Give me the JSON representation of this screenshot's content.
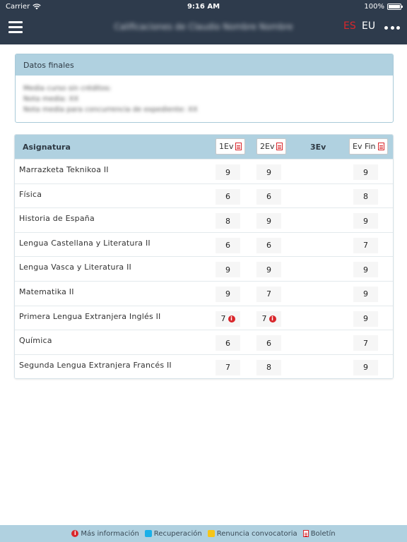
{
  "statusbar": {
    "carrier": "Carrier",
    "time": "9:16 AM",
    "battery": "100%"
  },
  "navbar": {
    "title": "Calificaciones de Claudio Nombre Nombre",
    "lang_es": "ES",
    "lang_eu": "EU"
  },
  "final": {
    "header": "Datos finales",
    "lines": [
      "Media curso sin créditos:",
      "Nota media: XX",
      "Nota media para concurrencia de expediente: XX"
    ]
  },
  "grades": {
    "header": {
      "subject": "Asignatura",
      "ev1": "1Ev",
      "ev2": "2Ev",
      "ev3": "3Ev",
      "evfin": "Ev Fin"
    },
    "rows": [
      {
        "subject": "Marrazketa Teknikoa II",
        "ev1": "9",
        "ev2": "9",
        "evfin": "9"
      },
      {
        "subject": "Física",
        "ev1": "6",
        "ev2": "6",
        "evfin": "8"
      },
      {
        "subject": "Historia de España",
        "ev1": "8",
        "ev2": "9",
        "evfin": "9"
      },
      {
        "subject": "Lengua Castellana y Literatura II",
        "ev1": "6",
        "ev2": "6",
        "evfin": "7"
      },
      {
        "subject": "Lengua Vasca y Literatura II",
        "ev1": "9",
        "ev2": "9",
        "evfin": "9"
      },
      {
        "subject": "Matematika II",
        "ev1": "9",
        "ev2": "7",
        "evfin": "9"
      },
      {
        "subject": "Primera Lengua Extranjera Inglés II",
        "ev1": "7",
        "ev2": "7",
        "evfin": "9",
        "info1": true,
        "info2": true
      },
      {
        "subject": "Química",
        "ev1": "6",
        "ev2": "6",
        "evfin": "7"
      },
      {
        "subject": "Segunda Lengua Extranjera Francés II",
        "ev1": "7",
        "ev2": "8",
        "evfin": "9"
      }
    ]
  },
  "legend": {
    "more_info": "Más información",
    "recovery": "Recuperación",
    "renounce": "Renuncia convocatoria",
    "bulletin": "Boletín",
    "recovery_color": "#1ab0e8",
    "renounce_color": "#f5c518",
    "info_color": "#d9262b"
  },
  "colors": {
    "nav_bg": "#2e3b4c",
    "header_bg": "#b0d1e0",
    "accent_red": "#d9262b"
  }
}
